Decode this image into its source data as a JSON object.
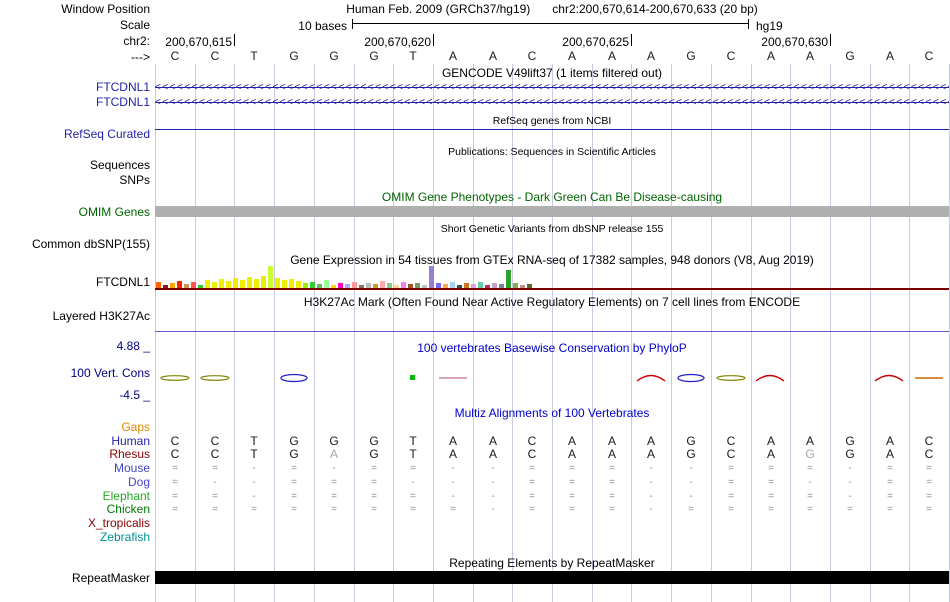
{
  "meta": {
    "window_position_label": "Window Position",
    "assembly_title": "Human Feb. 2009 (GRCh37/hg19)",
    "position": "chr2:200,670,614-200,670,633 (20 bp)",
    "scale_label": "Scale",
    "scale_text": "10 bases",
    "assembly": "hg19",
    "chrom_label": "chr2:",
    "strand_label": "--->"
  },
  "ruler": {
    "ticks": [
      {
        "label": "200,670,615",
        "col": 2
      },
      {
        "label": "200,670,620",
        "col": 7
      },
      {
        "label": "200,670,625",
        "col": 12
      },
      {
        "label": "200,670,630",
        "col": 17
      }
    ]
  },
  "sequence": [
    "C",
    "C",
    "T",
    "G",
    "G",
    "G",
    "T",
    "A",
    "A",
    "C",
    "A",
    "A",
    "A",
    "G",
    "C",
    "A",
    "A",
    "G",
    "A",
    "C"
  ],
  "tracks": {
    "gencode": {
      "title": "GENCODE V49lift37 (1 items filtered out)",
      "genes": [
        {
          "label": "FTCDNL1",
          "strand": "<"
        },
        {
          "label": "FTCDNL1",
          "strand": "<"
        }
      ]
    },
    "refseq": {
      "title": "RefSeq genes from NCBI",
      "label": "RefSeq Curated"
    },
    "publications": {
      "title": "Publications: Sequences in Scientific Articles",
      "row_labels": [
        "Sequences",
        "SNPs"
      ]
    },
    "omim": {
      "title": "OMIM Gene Phenotypes - Dark Green Can Be Disease-causing",
      "label": "OMIM Genes"
    },
    "dbsnp": {
      "title": "Short Genetic Variants from dbSNP release 155",
      "label": "Common dbSNP(155)"
    },
    "gtex": {
      "title": "Gene Expression in 54 tissues from GTEx RNA-seq of 17382 samples, 948 donors (V8, Aug 2019)",
      "label": "FTCDNL1"
    },
    "h3k27ac": {
      "title": "H3K27Ac Mark (Often Found Near Active Regulatory Elements) on 7 cell lines from ENCODE",
      "label": "Layered H3K27Ac"
    },
    "phylop": {
      "title": "100 vertebrates Basewise Conservation by PhyloP",
      "label": "100 Vert. Cons",
      "scale_max": "4.88 _",
      "scale_min": "-4.5 _"
    },
    "multiz": {
      "title": "Multiz Alignments of 100 Vertebrates"
    },
    "repeatmasker": {
      "title": "Repeating Elements by RepeatMasker",
      "label": "RepeatMasker"
    }
  },
  "chart_data": {
    "type": "bar",
    "title": "Gene Expression in 54 tissues from GTEx RNA-seq of 17382 samples, 948 donors (V8, Aug 2019)",
    "gene": "FTCDNL1",
    "unit": "relative expression (pixel height)",
    "bars": [
      {
        "h": 6,
        "c": "#FF6600"
      },
      {
        "h": 3,
        "c": "#8B1C1C"
      },
      {
        "h": 5,
        "c": "#FFAA00"
      },
      {
        "h": 7,
        "c": "#FF2200"
      },
      {
        "h": 4,
        "c": "#CC9955"
      },
      {
        "h": 6,
        "c": "#FF5555"
      },
      {
        "h": 3,
        "c": "#33CC33"
      },
      {
        "h": 8,
        "c": "#EEEE00"
      },
      {
        "h": 6,
        "c": "#EEEE00"
      },
      {
        "h": 9,
        "c": "#EEEE00"
      },
      {
        "h": 7,
        "c": "#EEEE00"
      },
      {
        "h": 10,
        "c": "#EEEE00"
      },
      {
        "h": 8,
        "c": "#EEEE00"
      },
      {
        "h": 11,
        "c": "#EEEE00"
      },
      {
        "h": 9,
        "c": "#EEEE00"
      },
      {
        "h": 12,
        "c": "#EEEE00"
      },
      {
        "h": 22,
        "c": "#CCFF33"
      },
      {
        "h": 10,
        "c": "#EEEE00"
      },
      {
        "h": 8,
        "c": "#EEEE00"
      },
      {
        "h": 9,
        "c": "#EEEE00"
      },
      {
        "h": 7,
        "c": "#EEEE00"
      },
      {
        "h": 5,
        "c": "#99EE00"
      },
      {
        "h": 6,
        "c": "#33CC33"
      },
      {
        "h": 4,
        "c": "#66BB66"
      },
      {
        "h": 8,
        "c": "#99FF99"
      },
      {
        "h": 3,
        "c": "#FFD700"
      },
      {
        "h": 5,
        "c": "#FF00BB"
      },
      {
        "h": 4,
        "c": "#AAAAFF"
      },
      {
        "h": 6,
        "c": "#FF9999"
      },
      {
        "h": 3,
        "c": "#8B7355"
      },
      {
        "h": 5,
        "c": "#BBBBBB"
      },
      {
        "h": 4,
        "c": "#CD9B1D"
      },
      {
        "h": 7,
        "c": "#FFAAAA"
      },
      {
        "h": 5,
        "c": "#88CC88"
      },
      {
        "h": 3,
        "c": "#FFD39B"
      },
      {
        "h": 6,
        "c": "#EE82EE"
      },
      {
        "h": 4,
        "c": "#A0522D"
      },
      {
        "h": 5,
        "c": "#779966"
      },
      {
        "h": 3,
        "c": "#C0C0C0"
      },
      {
        "h": 22,
        "c": "#9A7FD1"
      },
      {
        "h": 5,
        "c": "#7A67EE"
      },
      {
        "h": 4,
        "c": "#FFA54F"
      },
      {
        "h": 6,
        "c": "#A4D3EE"
      },
      {
        "h": 3,
        "c": "#2F4F4F"
      },
      {
        "h": 5,
        "c": "#CC7722"
      },
      {
        "h": 4,
        "c": "#DDA0DD"
      },
      {
        "h": 6,
        "c": "#66CDAA"
      },
      {
        "h": 3,
        "c": "#B03060"
      },
      {
        "h": 5,
        "c": "#C8A2C8"
      },
      {
        "h": 4,
        "c": "#778899"
      },
      {
        "h": 18,
        "c": "#2EA02E"
      },
      {
        "h": 5,
        "c": "#88AA55"
      },
      {
        "h": 3,
        "c": "#BC8F8F"
      },
      {
        "h": 4,
        "c": "#556B2F"
      }
    ]
  },
  "conservation_marks": [
    {
      "col": 0,
      "shape": "lens",
      "color": "#808000"
    },
    {
      "col": 1,
      "shape": "lens",
      "color": "#808000"
    },
    {
      "col": 3,
      "shape": "ellipse",
      "color": "#2222CC"
    },
    {
      "col": 6,
      "shape": "dot",
      "color": "#00BB00"
    },
    {
      "col": 7,
      "shape": "dash",
      "color": "#CC8899"
    },
    {
      "col": 12,
      "shape": "arc",
      "color": "#CC0000"
    },
    {
      "col": 13,
      "shape": "ellipse",
      "color": "#2222CC"
    },
    {
      "col": 14,
      "shape": "lens",
      "color": "#808000"
    },
    {
      "col": 15,
      "shape": "arc",
      "color": "#CC0000"
    },
    {
      "col": 18,
      "shape": "arc",
      "color": "#CC0000"
    },
    {
      "col": 19,
      "shape": "dash",
      "color": "#CC6600"
    }
  ],
  "alignments": {
    "rows": [
      {
        "species": "Gaps",
        "label_color": "#DD8800",
        "cells": [
          "",
          "",
          "",
          "",
          "",
          "",
          "",
          "",
          "",
          "",
          "",
          "",
          "",
          "",
          "",
          "",
          "",
          "",
          "",
          ""
        ]
      },
      {
        "species": "Human",
        "label_color": "#2222AA",
        "cells": [
          "C",
          "C",
          "T",
          "G",
          "G",
          "G",
          "T",
          "A",
          "A",
          "C",
          "A",
          "A",
          "A",
          "G",
          "C",
          "A",
          "A",
          "G",
          "A",
          "C"
        ]
      },
      {
        "species": "Rhesus",
        "label_color": "#8B0000",
        "cells": [
          "C",
          "C",
          "T",
          "G",
          "A",
          "G",
          "T",
          "A",
          "A",
          "C",
          "A",
          "A",
          "A",
          "G",
          "C",
          "A",
          "G",
          "G",
          "A",
          "C"
        ],
        "gray_cols": [
          4,
          16
        ]
      },
      {
        "species": "Mouse",
        "label_color": "#4444CC",
        "cells": [
          "=",
          "=",
          "-",
          "=",
          "-",
          "=",
          "=",
          "-",
          "-",
          "=",
          "=",
          "=",
          "-",
          "-",
          "=",
          "=",
          "=",
          "-",
          "=",
          "="
        ]
      },
      {
        "species": "Dog",
        "label_color": "#4444CC",
        "cells": [
          "=",
          "-",
          "-",
          "=",
          "=",
          "=",
          "-",
          "-",
          "-",
          "=",
          "=",
          "=",
          "-",
          "-",
          "=",
          "=",
          "-",
          "-",
          "=",
          "="
        ]
      },
      {
        "species": "Elephant",
        "label_color": "#22AA22",
        "cells": [
          "=",
          "=",
          "-",
          "=",
          "=",
          "=",
          "=",
          "-",
          "-",
          "=",
          "=",
          "=",
          "-",
          "-",
          "=",
          "=",
          "=",
          "-",
          "=",
          "="
        ]
      },
      {
        "species": "Chicken",
        "label_color": "#007700",
        "cells": [
          "=",
          "=",
          "=",
          "=",
          "=",
          "=",
          "=",
          "=",
          "-",
          "=",
          "=",
          "=",
          "-",
          "=",
          "=",
          "=",
          "=",
          "=",
          "=",
          "="
        ]
      },
      {
        "species": "X_tropicalis",
        "label_color": "#8B0000",
        "cells": [
          "",
          "",
          "",
          "",
          "",
          "",
          "",
          "",
          "",
          "",
          "",
          "",
          "",
          "",
          "",
          "",
          "",
          "",
          "",
          ""
        ]
      },
      {
        "species": "Zebrafish",
        "label_color": "#009090",
        "cells": [
          "",
          "",
          "",
          "",
          "",
          "",
          "",
          "",
          "",
          "",
          "",
          "",
          "",
          "",
          "",
          "",
          "",
          "",
          "",
          ""
        ]
      }
    ]
  }
}
